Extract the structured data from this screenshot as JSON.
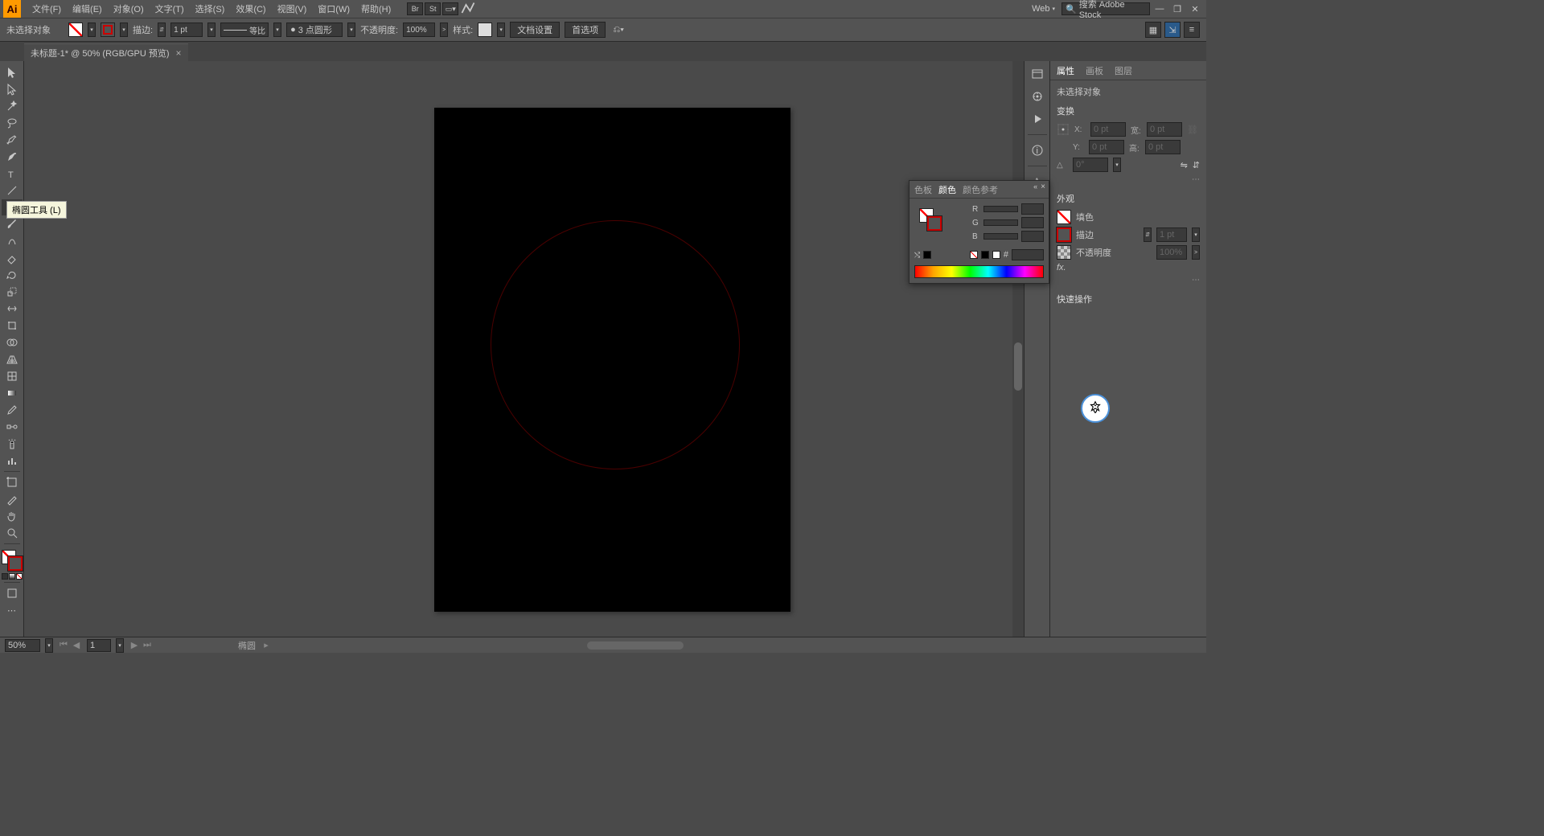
{
  "menubar": {
    "logo": "Ai",
    "items": [
      "文件(F)",
      "编辑(E)",
      "对象(O)",
      "文字(T)",
      "选择(S)",
      "效果(C)",
      "视图(V)",
      "窗口(W)",
      "帮助(H)"
    ],
    "web_label": "Web",
    "search_placeholder": "搜索 Adobe Stock"
  },
  "optbar": {
    "no_sel": "未选择对象",
    "stroke_label": "描边:",
    "stroke_weight": "1 pt",
    "uniform": "等比",
    "profile_pts": "3 点圆形",
    "opacity_label": "不透明度:",
    "opacity_value": "100%",
    "style_label": "样式:",
    "doc_setup": "文档设置",
    "prefs": "首选项"
  },
  "doc_tab": {
    "title": "未标题-1* @ 50% (RGB/GPU 预览)"
  },
  "tooltip": "椭圆工具 (L)",
  "color_panel": {
    "tabs": [
      "色板",
      "颜色",
      "颜色参考"
    ],
    "channels": [
      "R",
      "G",
      "B"
    ],
    "hash": "#"
  },
  "properties": {
    "tabs": [
      "属性",
      "画板",
      "图层"
    ],
    "no_sel": "未选择对象",
    "transform_title": "变换",
    "x_label": "X:",
    "y_label": "Y:",
    "w_label": "宽:",
    "h_label": "高:",
    "x_val": "0 pt",
    "y_val": "0 pt",
    "w_val": "0 pt",
    "h_val": "0 pt",
    "angle_label": "△",
    "angle_val": "0°",
    "appearance_title": "外观",
    "fill_label": "填色",
    "stroke_label": "描边",
    "stroke_weight": "1 pt",
    "opacity_label": "不透明度",
    "opacity_value": "100%",
    "fx_label": "fx.",
    "quick_title": "快速操作"
  },
  "status": {
    "zoom": "50%",
    "artboard": "1",
    "tool": "椭圆"
  }
}
